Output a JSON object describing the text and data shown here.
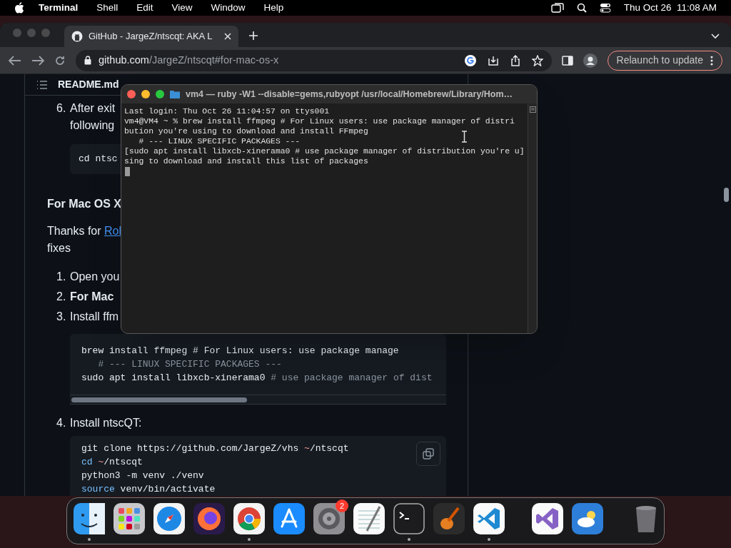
{
  "menu_bar": {
    "app": "Terminal",
    "menus": [
      "Shell",
      "Edit",
      "View",
      "Window",
      "Help"
    ],
    "clock": "Thu Oct 26  11:08 AM"
  },
  "browser": {
    "tab_title": "GitHub - JargeZ/ntscqt: AKA L",
    "url_host": "github.com",
    "url_path": "/JargeZ/ntscqt#for-mac-os-x",
    "relaunch": "Relaunch to update"
  },
  "readme": {
    "file": "README.md",
    "step6": {
      "number": "6.",
      "lines": [
        "After exit",
        "following"
      ],
      "code": "cd ntsc"
    },
    "heading": "For Mac OS X",
    "thanks": {
      "text": "Thanks for ",
      "link": "Rol",
      "rest": "fixes"
    },
    "steps": [
      {
        "number": "1.",
        "text": "Open you",
        "bold": false
      },
      {
        "number": "2.",
        "text": "For Mac",
        "bold": true
      },
      {
        "number": "3.",
        "text": "Install ffm",
        "bold": false
      }
    ],
    "code1": [
      [
        {
          "t": "brew install ffmpeg # For Linux users: use package manage",
          "kind": "plain"
        }
      ],
      [
        {
          "t": "   # --- LINUX SPECIFIC PACKAGES ---",
          "kind": "comment"
        }
      ],
      [
        {
          "t": "sudo apt install libxcb-xinerama0 ",
          "kind": "plain"
        },
        {
          "t": "# use package manager of dist",
          "kind": "comment"
        }
      ]
    ],
    "step4": {
      "number": "4.",
      "text": "Install ntscQT:"
    },
    "code2": [
      [
        {
          "t": "git clone https://github.com/JargeZ/vhs ",
          "kind": "plain"
        },
        {
          "t": "~",
          "kind": "tilde"
        },
        {
          "t": "/ntscqt",
          "kind": "plain"
        }
      ],
      [
        {
          "t": "cd",
          "kind": "builtin"
        },
        {
          "t": " ~",
          "kind": "tilde"
        },
        {
          "t": "/ntscqt",
          "kind": "plain"
        }
      ],
      [
        {
          "t": "python3 -m venv ./venv",
          "kind": "plain"
        }
      ],
      [
        {
          "t": "source",
          "kind": "builtin"
        },
        {
          "t": " venv/bin/activate",
          "kind": "plain"
        }
      ]
    ]
  },
  "terminal": {
    "title": "vm4 — ruby -W1 --disable=gems,rubyopt /usr/local/Homebrew/Library/Hom…",
    "lines": [
      "Last login: Thu Oct 26 11:04:57 on ttys001",
      "vm4@VM4 ~ % brew install ffmpeg # For Linux users: use package manager of distri",
      "bution you're using to download and install FFmpeg",
      "   # --- LINUX SPECIFIC PACKAGES ---",
      "[sudo apt install libxcb-xinerama0 # use package manager of distribution you're u]",
      "sing to download and install this list of packages"
    ]
  },
  "dock": {
    "apps": [
      {
        "kind": "finder",
        "running": true
      },
      {
        "kind": "launchpad",
        "running": false
      },
      {
        "kind": "safari",
        "running": false
      },
      {
        "kind": "firefox",
        "running": false
      },
      {
        "kind": "chrome",
        "running": true
      },
      {
        "kind": "appstore",
        "running": false
      },
      {
        "kind": "settings",
        "running": false,
        "badge": "2"
      },
      {
        "kind": "textedit",
        "running": false
      },
      {
        "kind": "terminal",
        "running": true
      },
      {
        "kind": "garageband",
        "running": false
      },
      {
        "kind": "vscode",
        "running": true
      },
      {
        "kind": "divider"
      },
      {
        "kind": "vstudio",
        "running": false
      },
      {
        "kind": "weather",
        "running": false
      },
      {
        "kind": "divider"
      },
      {
        "kind": "trash",
        "running": false
      }
    ]
  }
}
